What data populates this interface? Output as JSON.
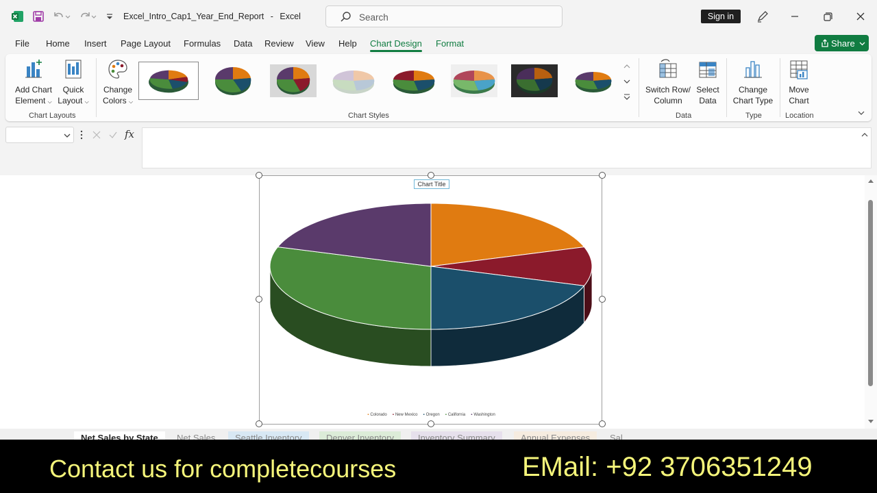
{
  "window": {
    "file_name": "Excel_Intro_Cap1_Year_End_Report",
    "separator": "-",
    "app_name": "Excel",
    "search_placeholder": "Search",
    "sign_in": "Sign in"
  },
  "menu": {
    "tabs": [
      "File",
      "Home",
      "Insert",
      "Page Layout",
      "Formulas",
      "Data",
      "Review",
      "View",
      "Help",
      "Chart Design",
      "Format"
    ],
    "active": "Chart Design",
    "share": "Share"
  },
  "ribbon": {
    "add_chart_element": [
      "Add Chart",
      "Element"
    ],
    "quick_layout": [
      "Quick",
      "Layout"
    ],
    "change_colors": [
      "Change",
      "Colors"
    ],
    "group_chart_layouts": "Chart Layouts",
    "group_chart_styles": "Chart Styles",
    "switch_row_column": [
      "Switch Row/",
      "Column"
    ],
    "select_data": [
      "Select",
      "Data"
    ],
    "group_data": "Data",
    "change_chart_type": [
      "Change",
      "Chart Type"
    ],
    "group_type": "Type",
    "move_chart": [
      "Move",
      "Chart"
    ],
    "group_location": "Location"
  },
  "formula_bar": {
    "fx": "fx"
  },
  "chart": {
    "title": "Chart Title"
  },
  "chart_data": {
    "type": "pie",
    "style": "3d",
    "title": "Chart Title",
    "categories": [
      "Colorado",
      "New Mexico",
      "Oregon",
      "California",
      "Washington"
    ],
    "values": [
      20,
      10,
      20,
      30,
      20
    ],
    "colors": [
      "#e07b11",
      "#8b1a2b",
      "#1b4f6b",
      "#4a8c3c",
      "#5a3a6b"
    ],
    "legend": "bottom"
  },
  "sheets": {
    "tabs": [
      "Net Sales by State",
      "Net Sales",
      "Seattle Inventory",
      "Denver Inventory",
      "Inventory Summary",
      "Annual Expenses",
      "Sal..."
    ],
    "active": "Net Sales by State"
  },
  "banner": {
    "left": "Contact us for completecourses",
    "right": "EMail: +92 3706351249"
  },
  "colors": {
    "accent": "#107c41",
    "banner_text": "#f5f57a"
  }
}
